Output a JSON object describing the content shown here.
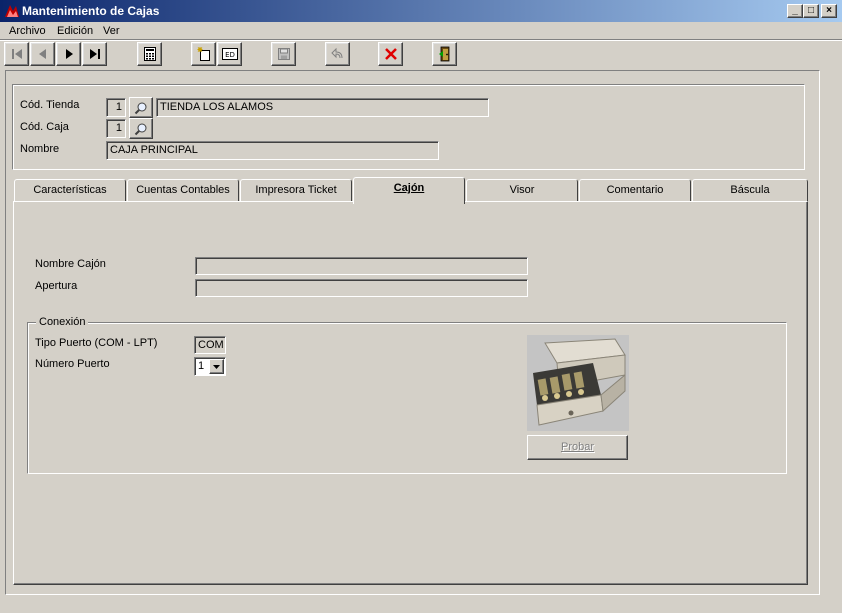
{
  "window": {
    "title": "Mantenimiento de Cajas",
    "controls": {
      "minimize": "_",
      "maximize": "□",
      "close": "×"
    }
  },
  "menu": [
    {
      "label": "Archivo"
    },
    {
      "label": "Edición"
    },
    {
      "label": "Ver"
    }
  ],
  "toolbar": {
    "icons": [
      "first-record-icon",
      "prev-record-icon",
      "next-record-icon",
      "last-record-icon",
      "calculator-icon",
      "new-record-icon",
      "edit-record-icon",
      "save-icon",
      "undo-icon",
      "delete-icon",
      "exit-icon"
    ]
  },
  "header": {
    "store_code_label": "Cód. Tienda",
    "store_code_value": "1",
    "store_name_value": "TIENDA LOS ALAMOS",
    "box_code_label": "Cód. Caja",
    "box_code_value": "1",
    "name_label": "Nombre",
    "name_value": "CAJA PRINCIPAL"
  },
  "tabs": [
    {
      "label": "Características",
      "active": false
    },
    {
      "label": "Cuentas Contables",
      "active": false
    },
    {
      "label": "Impresora Ticket",
      "active": false
    },
    {
      "label": "Cajón",
      "active": true
    },
    {
      "label": "Visor",
      "active": false
    },
    {
      "label": "Comentario",
      "active": false
    },
    {
      "label": "Báscula",
      "active": false
    }
  ],
  "drawer": {
    "name_label": "Nombre Cajón",
    "name_value": "",
    "opening_label": "Apertura",
    "opening_value": "",
    "connection_legend": "Conexión",
    "port_type_label": "Tipo Puerto (COM - LPT)",
    "port_type_value": "COM",
    "port_number_label": "Número Puerto",
    "port_number_value": "1",
    "test_button_label": "Probar"
  },
  "colors": {
    "title_start": "#0a246a",
    "title_end": "#a6caf0",
    "face": "#d4d0c8",
    "delete_red": "#e00000"
  }
}
